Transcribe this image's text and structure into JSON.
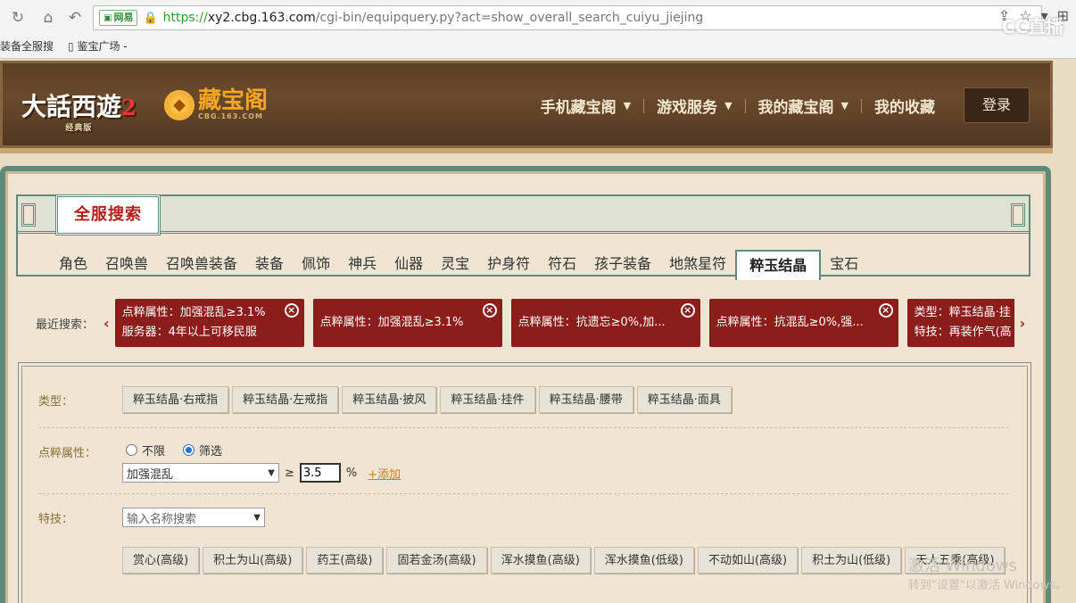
{
  "browser": {
    "url_https": "https://",
    "url_host": "xy2.cbg.163.com",
    "url_path": "/cgi-bin/equipquery.py?act=show_overall_search_cuiyu_jiejing",
    "ev_label": "网易",
    "bookmarks": [
      "装备全服搜",
      "鉴宝广场 -"
    ],
    "overlay_logo": "CC直播"
  },
  "header": {
    "game_logo": "大話西遊",
    "game_logo_num": "2",
    "game_logo_sub": "经典版",
    "site_logo": "藏宝阁",
    "site_logo_sub": "CBG.163.COM",
    "nav": [
      {
        "label": "手机藏宝阁",
        "caret": true
      },
      {
        "label": "游戏服务",
        "caret": true
      },
      {
        "label": "我的藏宝阁",
        "caret": true
      },
      {
        "label": "我的收藏",
        "caret": false
      }
    ],
    "login": "登录"
  },
  "search": {
    "title": "全服搜索",
    "tabs": [
      "角色",
      "召唤兽",
      "召唤兽装备",
      "装备",
      "佩饰",
      "神兵",
      "仙器",
      "灵宝",
      "护身符",
      "符石",
      "孩子装备",
      "地煞星符",
      "粹玉结晶",
      "宝石"
    ],
    "active_tab": "粹玉结晶"
  },
  "recent": {
    "label": "最近搜索：",
    "chips": [
      {
        "line1": "点粹属性：加强混乱≥3.1%",
        "line2": "服务器：4年以上可移民服"
      },
      {
        "line1": "点粹属性：加强混乱≥3.1%",
        "line2": ""
      },
      {
        "line1": "点粹属性：抗遗忘≥0%,加...",
        "line2": ""
      },
      {
        "line1": "点粹属性：抗混乱≥0%,强...",
        "line2": ""
      },
      {
        "line1": "类型：粹玉结晶·挂",
        "line2": "特技：再装作气(高"
      }
    ]
  },
  "form": {
    "type_label": "类型：",
    "types": [
      "粹玉结晶·右戒指",
      "粹玉结晶·左戒指",
      "粹玉结晶·披风",
      "粹玉结晶·挂件",
      "粹玉结晶·腰带",
      "粹玉结晶·面具"
    ],
    "attr_label": "点粹属性：",
    "radio_any": "不限",
    "radio_filter": "筛选",
    "attr_select": "加强混乱",
    "ge": "≥",
    "value": "3.5",
    "unit": "%",
    "add": "+添加",
    "skill_label": "特技：",
    "skill_placeholder": "输入名称搜索",
    "skills": [
      "赏心(高级)",
      "积土为山(高级)",
      "药王(高级)",
      "固若金汤(高级)",
      "浑水摸鱼(高级)",
      "浑水摸鱼(低级)",
      "不动如山(高级)",
      "积土为山(低级)",
      "天人五乘(高级)"
    ]
  },
  "watermark": {
    "line1": "激活 Windows",
    "line2": "转到\"设置\"以激活 Windows。"
  }
}
